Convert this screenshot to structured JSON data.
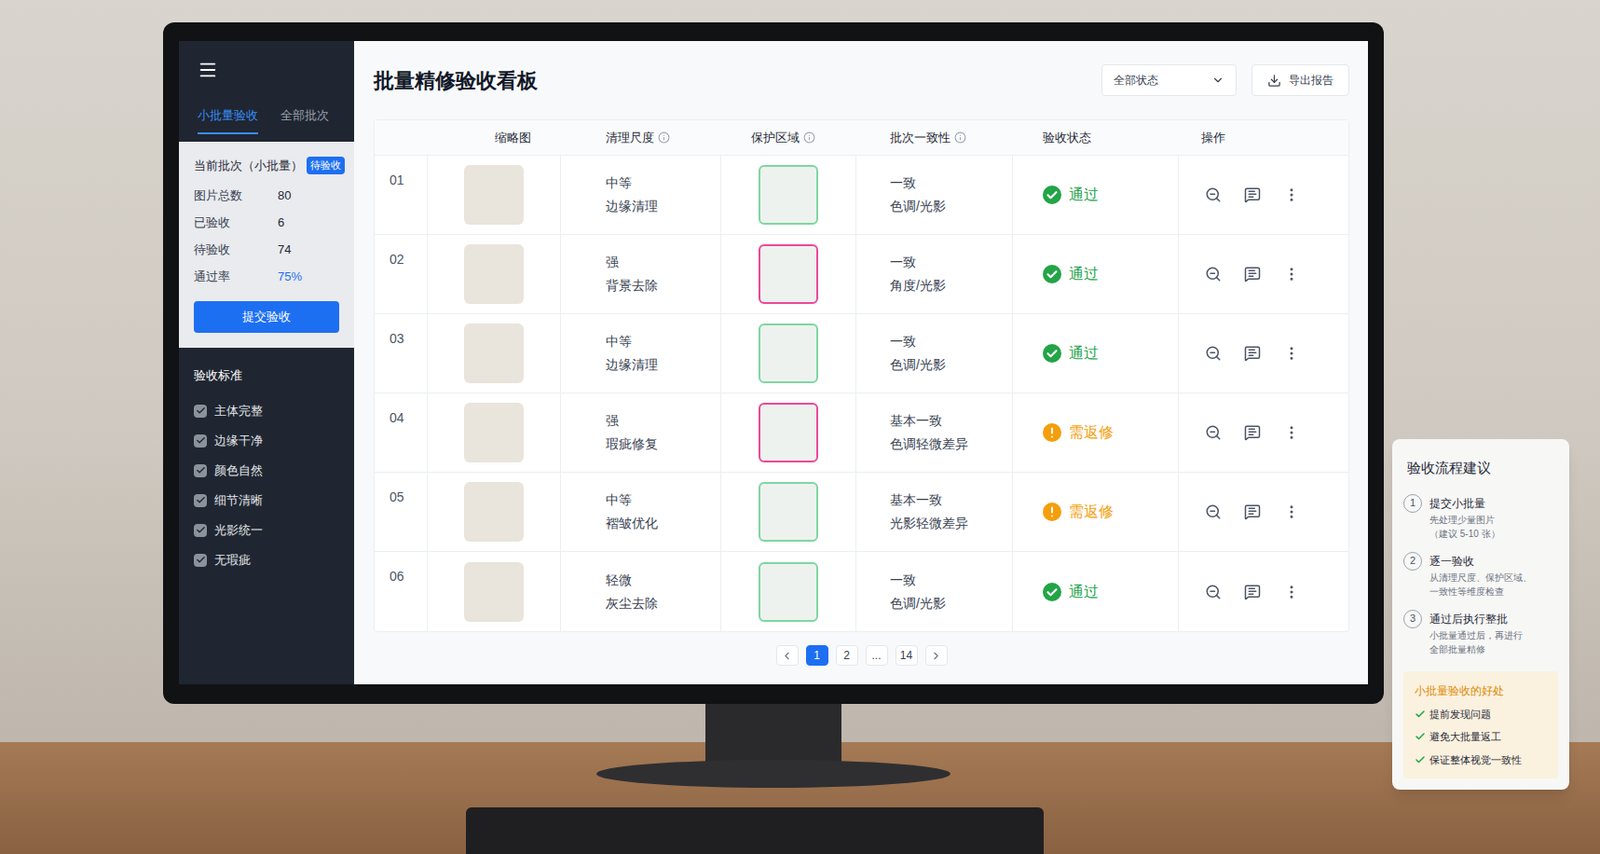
{
  "sidebar": {
    "tabs": [
      {
        "label": "小批量验收",
        "selected": true
      },
      {
        "label": "全部批次",
        "selected": false
      }
    ],
    "batch": {
      "title": "当前批次（小批量）",
      "badge": "待验收",
      "stats": [
        {
          "label": "图片总数",
          "value": "80",
          "highlight": false
        },
        {
          "label": "已验收",
          "value": "6",
          "highlight": false
        },
        {
          "label": "待验收",
          "value": "74",
          "highlight": false
        },
        {
          "label": "通过率",
          "value": "75%",
          "highlight": true
        }
      ],
      "button": "提交验收"
    },
    "criteria": {
      "title": "验收标准",
      "items": [
        {
          "label": "主体完整",
          "checked": true
        },
        {
          "label": "边缘干净",
          "checked": true
        },
        {
          "label": "颜色自然",
          "checked": true
        },
        {
          "label": "细节清晰",
          "checked": true
        },
        {
          "label": "光影统一",
          "checked": true
        },
        {
          "label": "无瑕疵",
          "checked": true
        }
      ]
    }
  },
  "header": {
    "title": "批量精修验收看板",
    "filter": "全部状态",
    "export": "导出报告"
  },
  "table": {
    "columns": [
      {
        "label": "",
        "info": false
      },
      {
        "label": "缩略图",
        "info": false
      },
      {
        "label": "清理尺度",
        "info": true
      },
      {
        "label": "保护区域",
        "info": true
      },
      {
        "label": "批次一致性",
        "info": true
      },
      {
        "label": "验收状态",
        "info": false
      },
      {
        "label": "操作",
        "info": false
      }
    ],
    "rows": [
      {
        "index": "01",
        "clean": [
          "中等",
          "边缘清理"
        ],
        "color": "#7fd6a2",
        "consistency": [
          "一致",
          "色调/光影"
        ],
        "status": {
          "label": "通过",
          "kind": "pass",
          "color": "#22a447"
        }
      },
      {
        "index": "02",
        "clean": [
          "强",
          "背景去除"
        ],
        "color": "#ec4899",
        "consistency": [
          "一致",
          "角度/光影"
        ],
        "status": {
          "label": "通过",
          "kind": "pass",
          "color": "#22a447"
        }
      },
      {
        "index": "03",
        "clean": [
          "中等",
          "边缘清理"
        ],
        "color": "#7fd6a2",
        "consistency": [
          "一致",
          "色调/光影"
        ],
        "status": {
          "label": "通过",
          "kind": "pass",
          "color": "#22a447"
        }
      },
      {
        "index": "04",
        "clean": [
          "强",
          "瑕疵修复"
        ],
        "color": "#ec4899",
        "consistency": [
          "基本一致",
          "色调轻微差异"
        ],
        "status": {
          "label": "需返修",
          "kind": "rework",
          "color": "#f59e0b"
        }
      },
      {
        "index": "05",
        "clean": [
          "中等",
          "褶皱优化"
        ],
        "color": "#7fd6a2",
        "consistency": [
          "基本一致",
          "光影轻微差异"
        ],
        "status": {
          "label": "需返修",
          "kind": "rework",
          "color": "#f59e0b"
        }
      },
      {
        "index": "06",
        "clean": [
          "轻微",
          "灰尘去除"
        ],
        "color": "#7fd6a2",
        "consistency": [
          "一致",
          "色调/光影"
        ],
        "status": {
          "label": "通过",
          "kind": "pass",
          "color": "#22a447"
        }
      }
    ]
  },
  "pagination": {
    "pages": [
      {
        "label": "1",
        "selected": true
      },
      {
        "label": "2",
        "selected": false
      },
      {
        "label": "...",
        "selected": false
      },
      {
        "label": "14",
        "selected": false
      }
    ]
  },
  "guide": {
    "title": "验收流程建议",
    "steps": [
      {
        "number": "1",
        "title": "提交小批量",
        "lines": [
          "先处理少量图片",
          "（建议 5-10 张）"
        ]
      },
      {
        "number": "2",
        "title": "逐一验收",
        "lines": [
          "从清理尺度、保护区域、",
          "一致性等维度检查"
        ]
      },
      {
        "number": "3",
        "title": "通过后执行整批",
        "lines": [
          "小批量通过后，再进行",
          "全部批量精修"
        ]
      }
    ],
    "benefits": {
      "title": "小批量验收的好处",
      "items": [
        "提前发现问题",
        "避免大批量返工",
        "保证整体视觉一致性"
      ]
    }
  }
}
